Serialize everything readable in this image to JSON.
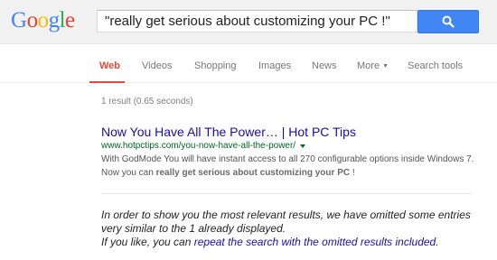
{
  "logo": {
    "letters": [
      "G",
      "o",
      "o",
      "g",
      "l",
      "e"
    ],
    "colors": [
      "#4285f4",
      "#ea4335",
      "#fbbc05",
      "#4285f4",
      "#34a853",
      "#ea4335"
    ]
  },
  "search": {
    "value": "\"really get serious about customizing your PC !\"",
    "button_icon": "search-icon"
  },
  "tabs": [
    {
      "label": "Web",
      "active": true
    },
    {
      "label": "Videos"
    },
    {
      "label": "Shopping"
    },
    {
      "label": "Images"
    },
    {
      "label": "News"
    },
    {
      "label": "More"
    },
    {
      "label": "Search tools"
    }
  ],
  "stats": "1 result (0.65 seconds)",
  "result": {
    "title": "Now You Have All The Power… | Hot PC Tips",
    "url": "www.hotpctips.com/you-now-have-all-the-power/",
    "snippet_part1": "With GodMode You will have instant access to all 270 configurable options inside Windows 7. Now you can ",
    "snippet_bold": "really get serious about customizing your PC",
    "snippet_part2": " !"
  },
  "omitted": {
    "line1": "In order to show you the most relevant results, we have omitted some entries very similar to the 1 already displayed.",
    "line2_prefix": "If you like, you can ",
    "link": "repeat the search with the omitted results included",
    "line2_suffix": "."
  }
}
